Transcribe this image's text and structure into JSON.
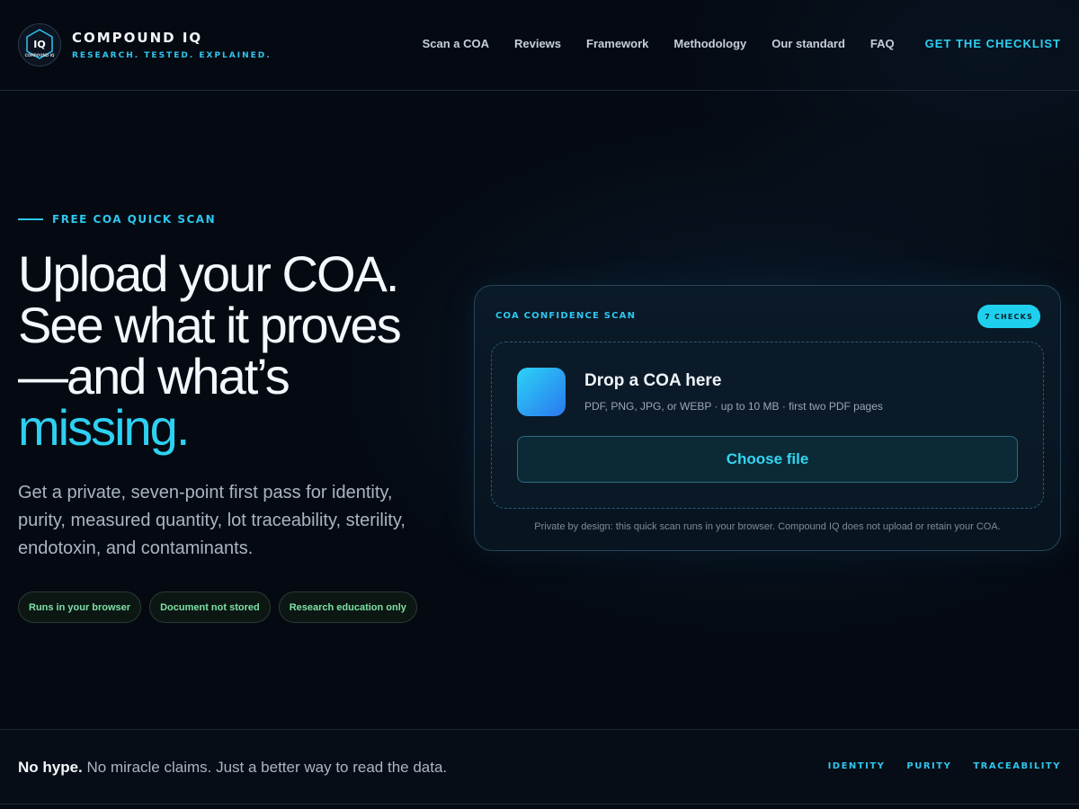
{
  "brand": {
    "name": "COMPOUND IQ",
    "tagline": "RESEARCH. TESTED. EXPLAINED.",
    "logo_text": "IQ",
    "logo_subtext": "COMPOUND IQ"
  },
  "nav": {
    "items": [
      {
        "label": "Scan a COA"
      },
      {
        "label": "Reviews"
      },
      {
        "label": "Framework"
      },
      {
        "label": "Methodology"
      },
      {
        "label": "Our standard"
      },
      {
        "label": "FAQ"
      }
    ],
    "cta": "GET THE CHECKLIST"
  },
  "hero": {
    "eyebrow": "FREE COA QUICK SCAN",
    "headline_lines": [
      "Upload your COA.",
      "See what it proves",
      "—and what’s"
    ],
    "headline_accent": "missing.",
    "lede": "Get a private, seven-point first pass for identity, purity, measured quantity, lot traceability, sterility, endotoxin, and contaminants.",
    "pills": [
      "Runs in your browser",
      "Document not stored",
      "Research education only"
    ]
  },
  "scan_card": {
    "title": "COA CONFIDENCE SCAN",
    "badge": "7 CHECKS",
    "drop_title": "Drop a COA here",
    "drop_subtitle": "PDF, PNG, JPG, or WEBP · up to 10 MB · first two PDF pages",
    "button_label": "Choose file",
    "privacy_note": "Private by design: this quick scan runs in your browser. Compound IQ does not upload or retain your COA."
  },
  "strip": {
    "bold": "No hype.",
    "text": " No miracle claims. Just a better way to read the data.",
    "tags": [
      "IDENTITY",
      "PURITY",
      "TRACEABILITY"
    ]
  },
  "colors": {
    "accent": "#2ed0f2",
    "background": "#050a12",
    "pill_text": "#7fe0a4"
  }
}
